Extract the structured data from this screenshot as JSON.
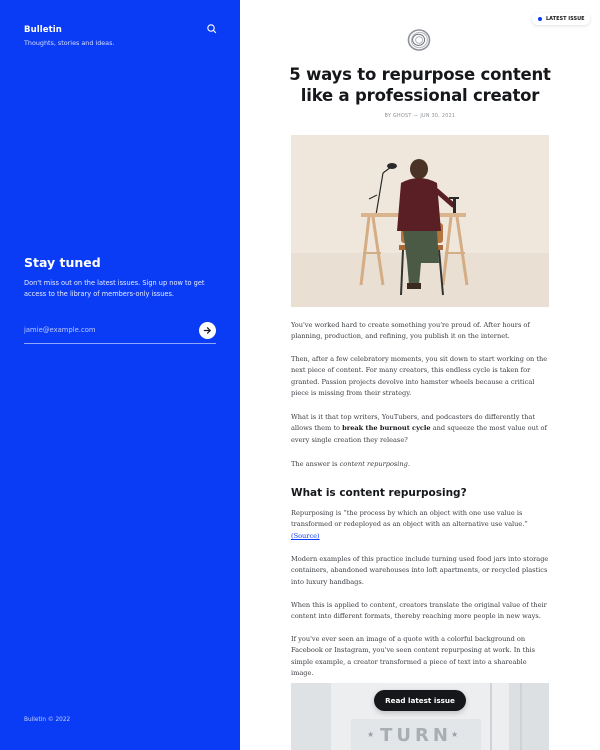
{
  "sidebar": {
    "brand": "Bulletin",
    "tagline": "Thoughts, stories and ideas.",
    "subscribe": {
      "title": "Stay tuned",
      "description": "Don't miss out on the latest issues. Sign up now to get access to the library of members-only issues.",
      "email_placeholder": "jamie@example.com",
      "submit_icon": "arrow-right-icon"
    },
    "footer": "Bulletin © 2022",
    "search_icon": "search-icon",
    "background_color": "#0b3cf5"
  },
  "main": {
    "badge": "LATEST ISSUE",
    "post": {
      "title": "5 ways to repurpose content like a professional creator",
      "meta": "BY GHOST — JUN 30, 2021",
      "paragraphs": {
        "p1": "You've worked hard to create something you're proud of. After hours of planning, production, and refining, you publish it on the internet.",
        "p2": "Then, after a few celebratory moments, you sit down to start working on the next piece of content. For many creators, this endless cycle is taken for granted. Passion projects devolve into hamster wheels because a critical piece is missing from their strategy.",
        "p3_start": "What is it that top writers, YouTubers, and podcasters do differently that allows them to ",
        "p3_bold": "break the burnout cycle",
        "p3_end": " and squeeze the most value out of every single creation they release?",
        "p4_start": "The answer is ",
        "p4_em": "content repurposing",
        "p4_end": ".",
        "heading": "What is content repurposing?",
        "p5": "Repurposing is “the process by which an object with one use value is transformed or redeployed as an object with an alternative use value.”",
        "p5_link": "(Source)",
        "p6": "Modern examples of this practice include turning used food jars into storage containers, abandoned warehouses into loft apartments, or recycled plastics into luxury handbags.",
        "p7": "When this is applied to content, creators translate the original value of their content into different formats, thereby reaching more people in new ways.",
        "p8": "If you've ever seen an image of a quote with a colorful background on Facebook or Instagram, you've seen content repurposing at work. In this simple example, a creator transformed a piece of text into a shareable image."
      }
    },
    "read_latest_button": "Read latest issue",
    "bottom_image_text": "TURN",
    "accent_color": "#0b3cf5"
  }
}
